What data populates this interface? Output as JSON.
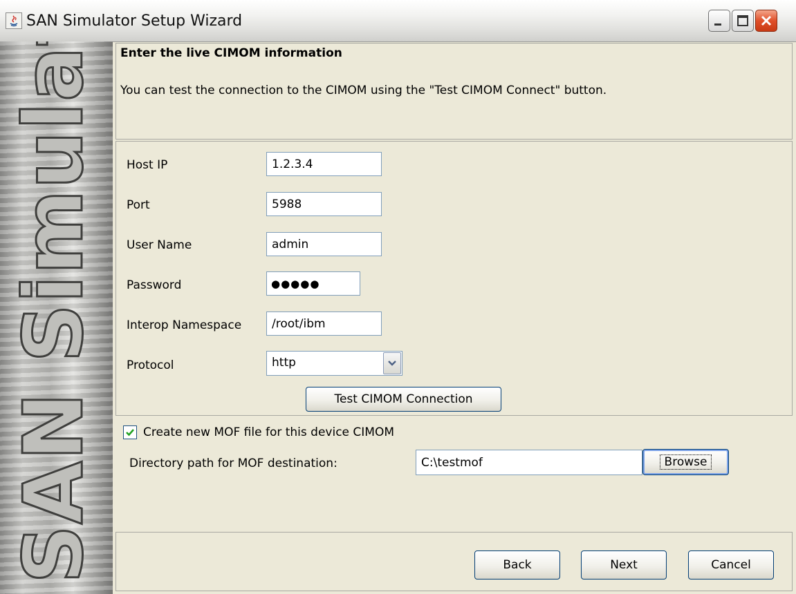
{
  "window": {
    "title": "SAN Simulator Setup Wizard"
  },
  "banner": {
    "text": "SAN Simulator"
  },
  "header": {
    "title": "Enter the live CIMOM information",
    "description": "You can test the connection to the CIMOM using the \"Test CIMOM Connect\" button."
  },
  "form": {
    "host_ip": {
      "label": "Host IP",
      "value": "1.2.3.4"
    },
    "port": {
      "label": "Port",
      "value": "5988"
    },
    "user_name": {
      "label": "User Name",
      "value": "admin"
    },
    "password": {
      "label": "Password",
      "masked": "●●●●●"
    },
    "interop_namespace": {
      "label": "Interop Namespace",
      "value": "/root/ibm"
    },
    "protocol": {
      "label": "Protocol",
      "value": "http"
    },
    "test_button": "Test CIMOM Connection"
  },
  "mof": {
    "checkbox_label": "Create new MOF file for this device CIMOM",
    "checked": true,
    "dir_label": "Directory path for MOF destination:",
    "dir_value": "C:\\testmof",
    "browse_button": "Browse"
  },
  "nav": {
    "back": "Back",
    "next": "Next",
    "cancel": "Cancel"
  },
  "colors": {
    "field_border": "#7f9db9",
    "button_border": "#003c74",
    "close_red": "#e0502a",
    "panel_bg": "#ece9d8"
  }
}
